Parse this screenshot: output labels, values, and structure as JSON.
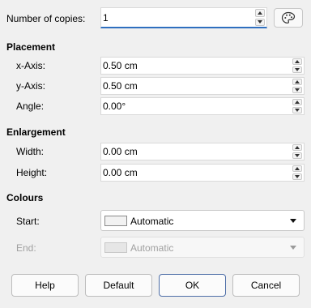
{
  "copies": {
    "label": "Number of copies:",
    "value": "1",
    "color_button_icon": "palette-icon"
  },
  "placement": {
    "title": "Placement",
    "x_axis": {
      "label": "x-Axis:",
      "value": "0.50 cm"
    },
    "y_axis": {
      "label": "y-Axis:",
      "value": "0.50 cm"
    },
    "angle": {
      "label": "Angle:",
      "value": "0.00°"
    }
  },
  "enlargement": {
    "title": "Enlargement",
    "width": {
      "label": "Width:",
      "value": "0.00 cm"
    },
    "height": {
      "label": "Height:",
      "value": "0.00 cm"
    }
  },
  "colours": {
    "title": "Colours",
    "start": {
      "label": "Start:",
      "value": "Automatic"
    },
    "end": {
      "label": "End:",
      "value": "Automatic"
    }
  },
  "buttons": {
    "help": "Help",
    "default": "Default",
    "ok": "OK",
    "cancel": "Cancel"
  },
  "colors": {
    "accent": "#2f6fbf",
    "background": "#f0f0f0"
  }
}
